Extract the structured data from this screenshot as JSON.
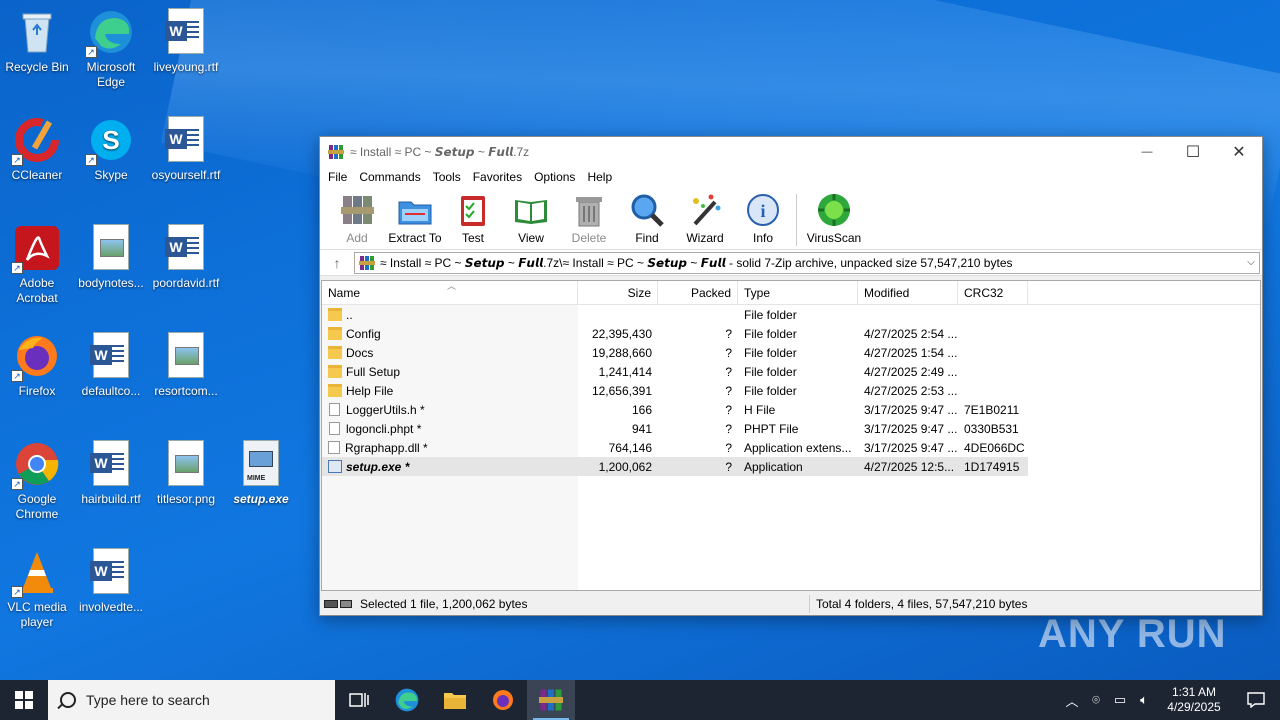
{
  "desktop": {
    "icons": [
      {
        "label": "Recycle Bin"
      },
      {
        "label": "Microsoft Edge"
      },
      {
        "label": "liveyoung.rtf"
      },
      {
        "label": "CCleaner"
      },
      {
        "label": "Skype"
      },
      {
        "label": "osyourself.rtf"
      },
      {
        "label": "Adobe Acrobat"
      },
      {
        "label": "bodynotes..."
      },
      {
        "label": "poordavid.rtf"
      },
      {
        "label": "Firefox"
      },
      {
        "label": "defaultco..."
      },
      {
        "label": "resortcom..."
      },
      {
        "label": "Google Chrome"
      },
      {
        "label": "hairbuild.rtf"
      },
      {
        "label": "titlesor.png"
      },
      {
        "label": "setup.exe"
      },
      {
        "label": "VLC media player"
      },
      {
        "label": "involvedte..."
      }
    ],
    "watermark": "ANY RUN"
  },
  "window": {
    "title": "≈ Install ≈ PC ~ 𝙎𝙚𝙩𝙪𝙥 ~ 𝙁𝙪𝙡𝙡.7z",
    "controls": {
      "minimize": "—",
      "maximize": "☐",
      "close": "✕"
    },
    "menu": [
      "File",
      "Commands",
      "Tools",
      "Favorites",
      "Options",
      "Help"
    ],
    "toolbar": [
      {
        "label": "Add",
        "icon": "add-archive-icon",
        "enabled": false
      },
      {
        "label": "Extract To",
        "icon": "extract-folder-icon",
        "enabled": true
      },
      {
        "label": "Test",
        "icon": "test-clipboard-icon",
        "enabled": true
      },
      {
        "label": "View",
        "icon": "view-book-icon",
        "enabled": true
      },
      {
        "label": "Delete",
        "icon": "trash-icon",
        "enabled": false
      },
      {
        "label": "Find",
        "icon": "magnifier-icon",
        "enabled": true
      },
      {
        "label": "Wizard",
        "icon": "wizard-wand-icon",
        "enabled": true
      },
      {
        "label": "Info",
        "icon": "info-icon",
        "enabled": true
      },
      {
        "label": "VirusScan",
        "icon": "virus-scan-icon",
        "enabled": true
      }
    ],
    "address": "≈ Install ≈ PC ~ 𝙎𝙚𝙩𝙪𝙥 ~ 𝙁𝙪𝙡𝙡.7z\\≈ Install ≈ PC ~ 𝙎𝙚𝙩𝙪𝙥 ~ 𝙁𝙪𝙡𝙡 - solid 7-Zip archive, unpacked size 57,547,210 bytes",
    "columns": {
      "name": "Name",
      "size": "Size",
      "packed": "Packed",
      "type": "Type",
      "modified": "Modified",
      "crc": "CRC32"
    },
    "rows": [
      {
        "name": "..",
        "size": "",
        "packed": "",
        "type": "File folder",
        "modified": "",
        "crc": "",
        "kind": "folder"
      },
      {
        "name": "Config",
        "size": "22,395,430",
        "packed": "?",
        "type": "File folder",
        "modified": "4/27/2025 2:54 ...",
        "crc": "",
        "kind": "folder"
      },
      {
        "name": "Docs",
        "size": "19,288,660",
        "packed": "?",
        "type": "File folder",
        "modified": "4/27/2025 1:54 ...",
        "crc": "",
        "kind": "folder"
      },
      {
        "name": "Full Setup",
        "size": "1,241,414",
        "packed": "?",
        "type": "File folder",
        "modified": "4/27/2025 2:49 ...",
        "crc": "",
        "kind": "folder"
      },
      {
        "name": "Help File",
        "size": "12,656,391",
        "packed": "?",
        "type": "File folder",
        "modified": "4/27/2025 2:53 ...",
        "crc": "",
        "kind": "folder"
      },
      {
        "name": "LoggerUtils.h *",
        "size": "166",
        "packed": "?",
        "type": "H File",
        "modified": "3/17/2025 9:47 ...",
        "crc": "7E1B0211",
        "kind": "file"
      },
      {
        "name": "logoncli.phpt *",
        "size": "941",
        "packed": "?",
        "type": "PHPT File",
        "modified": "3/17/2025 9:47 ...",
        "crc": "0330B531",
        "kind": "file"
      },
      {
        "name": "Rgraphapp.dll *",
        "size": "764,146",
        "packed": "?",
        "type": "Application extens...",
        "modified": "3/17/2025 9:47 ...",
        "crc": "4DE066DC",
        "kind": "dll"
      },
      {
        "name": "setup.exe *",
        "size": "1,200,062",
        "packed": "?",
        "type": "Application",
        "modified": "4/27/2025 12:5...",
        "crc": "1D174915",
        "kind": "exe",
        "selected": true
      }
    ],
    "status": {
      "left": "Selected 1 file, 1,200,062 bytes",
      "right": "Total 4 folders, 4 files, 57,547,210 bytes"
    }
  },
  "taskbar": {
    "search_placeholder": "Type here to search",
    "time": "1:31 AM",
    "date": "4/29/2025"
  }
}
